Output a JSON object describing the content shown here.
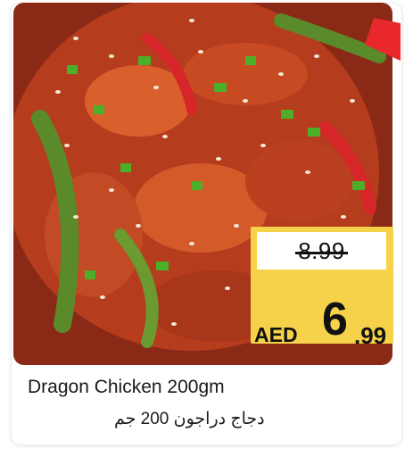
{
  "product": {
    "name_en": "Dragon Chicken 200gm",
    "name_ar": "دجاج دراجون 200 جم",
    "image": "dragon-chicken-dish"
  },
  "price": {
    "old": "8.99",
    "currency": "AED",
    "new_int": "6",
    "new_dec": ".99"
  },
  "colors": {
    "price_badge": "#f6d24a",
    "corner_tag": "#e8282a"
  }
}
